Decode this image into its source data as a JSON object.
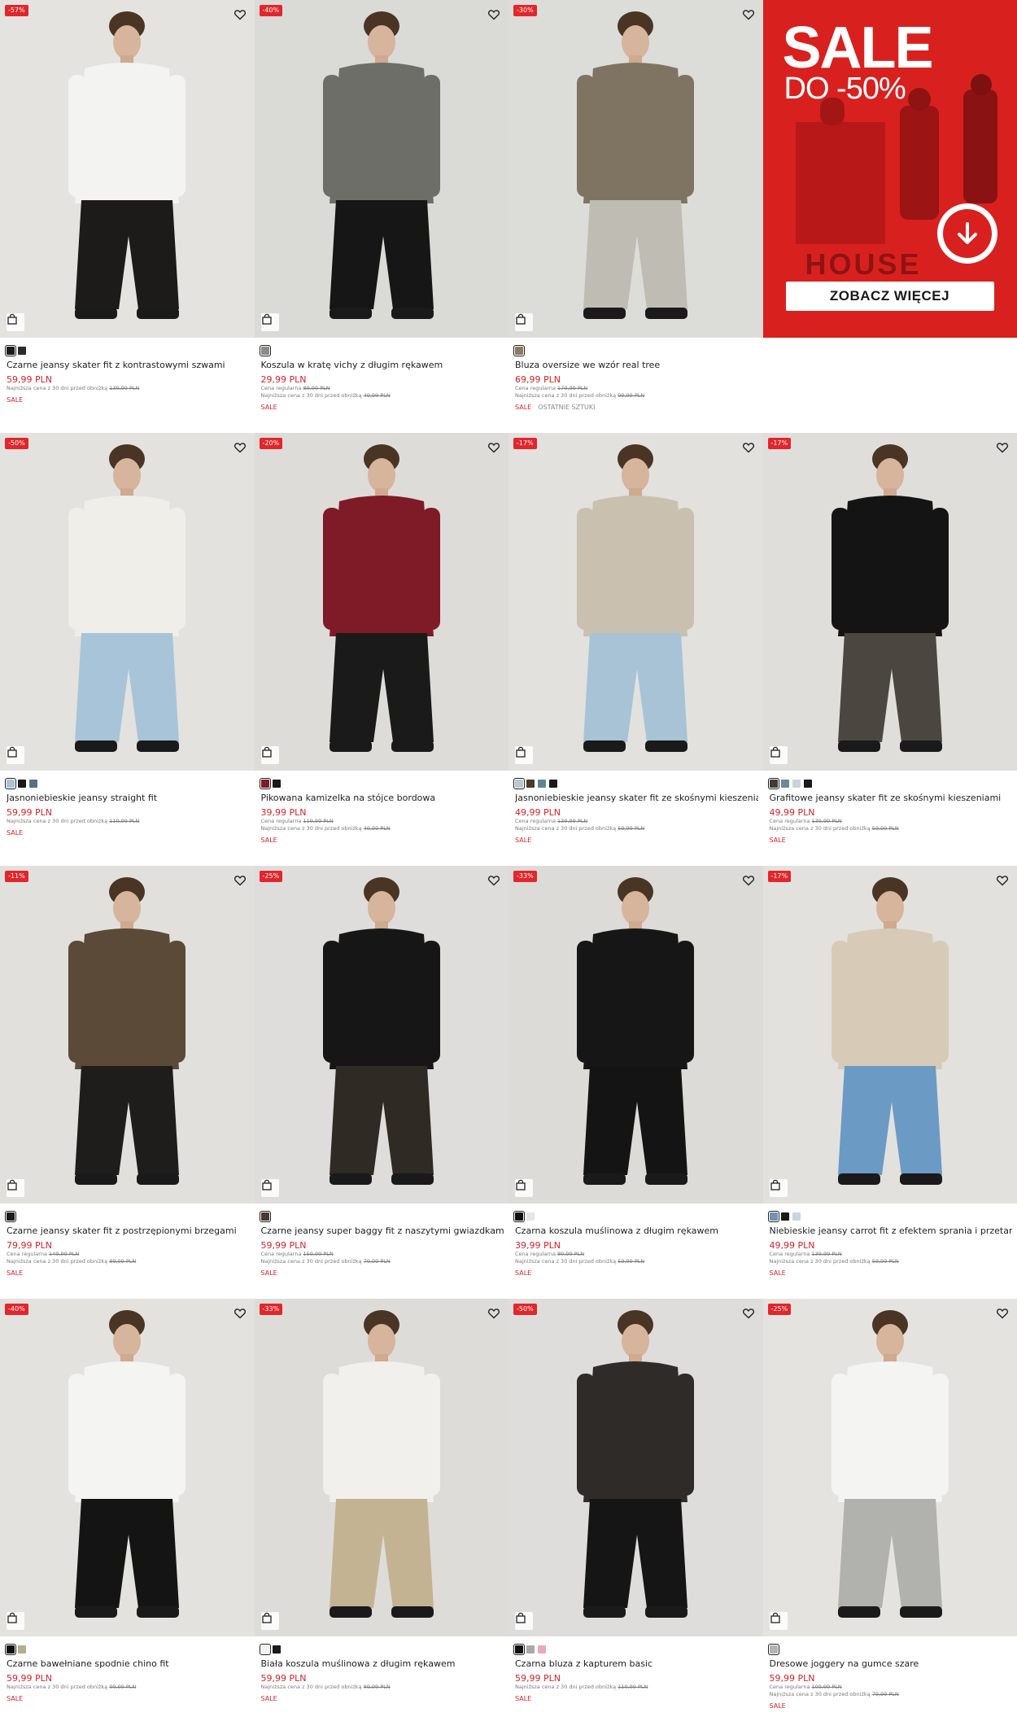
{
  "promo": {
    "headline": "SALE",
    "subline": "DO -50%",
    "logo": "HOUSE",
    "cta_label": "ZOBACZ WIĘCEJ",
    "background": "#d8211f"
  },
  "labels": {
    "regular_prefix": "Cena regularna",
    "lowest_prefix": "Najniższa cena z 30 dni przed obniżką",
    "sale_tag": "SALE",
    "last_pieces_tag": "OSTATNIE SZTUKI"
  },
  "icons": {
    "favorite": "heart-icon",
    "quick_add": "shopping-bag-icon",
    "promo_arrow": "arrow-down-circle-icon"
  },
  "products": [
    {
      "discount": "-57%",
      "name": "Czarne jeansy skater fit z kontrastowymi szwami",
      "price": "59,99 PLN",
      "regular": "",
      "lowest": "139,99 PLN",
      "last": "",
      "swatches": [
        "#1c1c1c",
        "#2a2a2a"
      ],
      "top": "#f3f3f1",
      "bottom": "#1d1b1a",
      "bg": "#e4e3e0"
    },
    {
      "discount": "-40%",
      "name": "Koszula w kratę vichy z długim rękawem",
      "price": "29,99 PLN",
      "regular": "89,99 PLN",
      "lowest": "49,99 PLN",
      "last": "",
      "swatches": [
        "#8c8c86"
      ],
      "top": "#6e6e69",
      "bottom": "#161616",
      "bg": "#dadad7"
    },
    {
      "discount": "-30%",
      "name": "Bluza oversize we wzór real tree",
      "price": "69,99 PLN",
      "regular": "179,99 PLN",
      "lowest": "99,99 PLN",
      "last": "OSTATNIE SZTUKI",
      "swatches": [
        "#8b7b63"
      ],
      "top": "#7f7462",
      "bottom": "#bfbcb4",
      "bg": "#dcdcd9"
    },
    {
      "discount": "-50%",
      "name": "Jasnoniebieskie jeansy straight fit",
      "price": "59,99 PLN",
      "regular": "",
      "lowest": "119,99 PLN",
      "last": "",
      "swatches": [
        "#a9c3d6",
        "#1a1a1a",
        "#56708a"
      ],
      "top": "#f0eee8",
      "bottom": "#a8c4d8",
      "bg": "#e3e2df"
    },
    {
      "discount": "-20%",
      "name": "Pikowana kamizelka na stójce bordowa",
      "price": "39,99 PLN",
      "regular": "119,99 PLN",
      "lowest": "49,99 PLN",
      "last": "",
      "swatches": [
        "#7d1d27",
        "#1a1a1a"
      ],
      "top": "#7e1b26",
      "bottom": "#1a1a1a",
      "bg": "#dddcd9"
    },
    {
      "discount": "-17%",
      "name": "Jasnoniebieskie jeansy skater fit ze skośnymi kieszeniami",
      "price": "49,99 PLN",
      "regular": "139,99 PLN",
      "lowest": "59,99 PLN",
      "last": "",
      "swatches": [
        "#b7c9cf",
        "#4a3a2d",
        "#5f8597",
        "#1a1a1a"
      ],
      "top": "#c9c0b0",
      "bottom": "#a7c3d5",
      "bg": "#e2e1de"
    },
    {
      "discount": "-17%",
      "name": "Grafitowe jeansy skater fit ze skośnymi kieszeniami",
      "price": "49,99 PLN",
      "regular": "139,99 PLN",
      "lowest": "59,99 PLN",
      "last": "",
      "swatches": [
        "#3d3d3b",
        "#6e8a96",
        "#c9d4d8",
        "#1a1a1a"
      ],
      "top": "#141414",
      "bottom": "#4b4640",
      "bg": "#dfdedb"
    },
    {
      "discount": "-11%",
      "name": "Czarne jeansy skater fit z postrzępionymi brzegami",
      "price": "79,99 PLN",
      "regular": "149,99 PLN",
      "lowest": "89,99 PLN",
      "last": "",
      "swatches": [
        "#1c1c1c"
      ],
      "top": "#5a4a37",
      "bottom": "#1f1d1c",
      "bg": "#e1e0dd"
    },
    {
      "discount": "-25%",
      "name": "Czarne jeansy super baggy fit z naszytymi gwiazdkami",
      "price": "59,99 PLN",
      "regular": "159,99 PLN",
      "lowest": "79,99 PLN",
      "last": "",
      "swatches": [
        "#4b3b2a"
      ],
      "top": "#161616",
      "bottom": "#2f2a24",
      "bg": "#dedddb"
    },
    {
      "discount": "-33%",
      "name": "Czarna koszula muślinowa z długim rękawem",
      "price": "39,99 PLN",
      "regular": "89,99 PLN",
      "lowest": "59,99 PLN",
      "last": "",
      "swatches": [
        "#111111",
        "#e6e6e6"
      ],
      "top": "#161616",
      "bottom": "#141414",
      "bg": "#dcdbd8"
    },
    {
      "discount": "-17%",
      "name": "Niebieskie jeansy carrot fit z efektem sprania i przetarciami",
      "price": "49,99 PLN",
      "regular": "139,99 PLN",
      "lowest": "59,99 PLN",
      "last": "",
      "swatches": [
        "#6f93b3",
        "#1a1a1a",
        "#c8d5dc"
      ],
      "top": "#d7cbb7",
      "bottom": "#6b9ac4",
      "bg": "#e2e1de"
    },
    {
      "discount": "-40%",
      "name": "Czarne bawełniane spodnie chino fit",
      "price": "59,99 PLN",
      "regular": "",
      "lowest": "99,99 PLN",
      "last": "",
      "swatches": [
        "#111111",
        "#b7ad8e"
      ],
      "top": "#f4f4f2",
      "bottom": "#141414",
      "bg": "#e3e2df"
    },
    {
      "discount": "-33%",
      "name": "Biała koszula muślinowa z długim rękawem",
      "price": "59,99 PLN",
      "regular": "",
      "lowest": "89,99 PLN",
      "last": "",
      "swatches": [
        "#f2f2f0",
        "#1a1a1a"
      ],
      "top": "#f1f0ec",
      "bottom": "#c4b393",
      "bg": "#dddcd9"
    },
    {
      "discount": "-50%",
      "name": "Czarna bluza z kapturem basic",
      "price": "59,99 PLN",
      "regular": "",
      "lowest": "119,99 PLN",
      "last": "",
      "swatches": [
        "#111111",
        "#a9a9a6",
        "#e9a8bb"
      ],
      "top": "#2f2b29",
      "bottom": "#151515",
      "bg": "#dedddb"
    },
    {
      "discount": "-25%",
      "name": "Dresowe joggery na gumce szare",
      "price": "59,99 PLN",
      "regular": "109,99 PLN",
      "lowest": "79,99 PLN",
      "last": "",
      "swatches": [
        "#b4b4b2"
      ],
      "top": "#f4f4f2",
      "bottom": "#b1b1ae",
      "bg": "#e4e3e0"
    }
  ]
}
